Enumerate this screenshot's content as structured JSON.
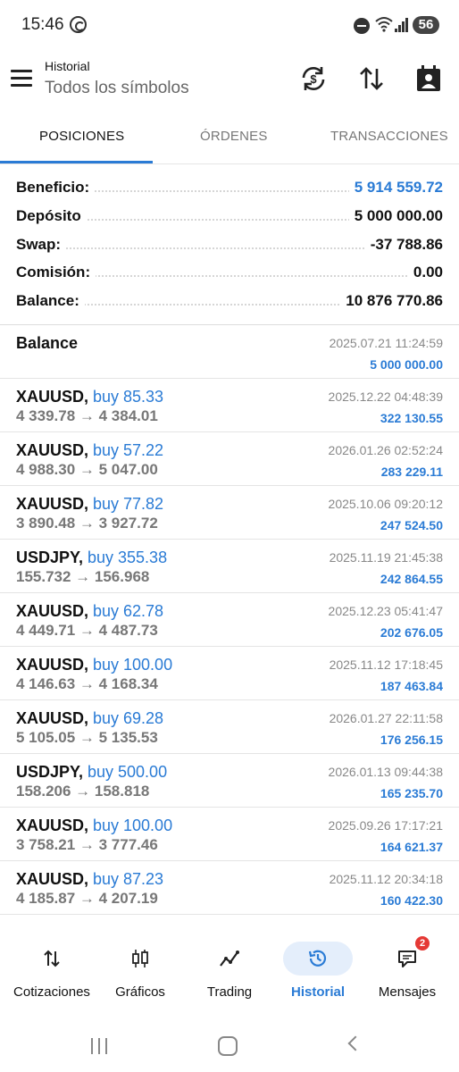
{
  "status_bar": {
    "time": "15:46",
    "battery": "56"
  },
  "app_bar": {
    "title": "Historial",
    "subtitle": "Todos los símbolos",
    "icons": [
      "menu-icon",
      "currency-sync-icon",
      "sort-icon",
      "calendar-person-icon"
    ]
  },
  "tabs": [
    {
      "label": "POSICIONES",
      "active": true
    },
    {
      "label": "ÓRDENES",
      "active": false
    },
    {
      "label": "TRANSACCIONES",
      "active": false
    }
  ],
  "summary": [
    {
      "label": "Beneficio:",
      "value": "5 914 559.72",
      "accent": true
    },
    {
      "label": "Depósito",
      "value": "5 000 000.00",
      "accent": false
    },
    {
      "label": "Swap:",
      "value": "-37 788.86",
      "accent": false
    },
    {
      "label": "Comisión:",
      "value": "0.00",
      "accent": false
    },
    {
      "label": "Balance:",
      "value": "10 876 770.86",
      "accent": false
    }
  ],
  "balance_entry": {
    "title": "Balance",
    "time": "2025.07.21 11:24:59",
    "amount": "5 000 000.00"
  },
  "deals": [
    {
      "symbol": "XAUUSD,",
      "side": "buy 85.33",
      "prices": "4 339.78 → 4 384.01",
      "time": "2025.12.22 04:48:39",
      "profit": "322 130.55"
    },
    {
      "symbol": "XAUUSD,",
      "side": "buy 57.22",
      "prices": "4 988.30 → 5 047.00",
      "time": "2026.01.26 02:52:24",
      "profit": "283 229.11"
    },
    {
      "symbol": "XAUUSD,",
      "side": "buy 77.82",
      "prices": "3 890.48 → 3 927.72",
      "time": "2025.10.06 09:20:12",
      "profit": "247 524.50"
    },
    {
      "symbol": "USDJPY,",
      "side": "buy 355.38",
      "prices": "155.732 → 156.968",
      "time": "2025.11.19 21:45:38",
      "profit": "242 864.55"
    },
    {
      "symbol": "XAUUSD,",
      "side": "buy 62.78",
      "prices": "4 449.71 → 4 487.73",
      "time": "2025.12.23 05:41:47",
      "profit": "202 676.05"
    },
    {
      "symbol": "XAUUSD,",
      "side": "buy 100.00",
      "prices": "4 146.63 → 4 168.34",
      "time": "2025.11.12 17:18:45",
      "profit": "187 463.84"
    },
    {
      "symbol": "XAUUSD,",
      "side": "buy 69.28",
      "prices": "5 105.05 → 5 135.53",
      "time": "2026.01.27 22:11:58",
      "profit": "176 256.15"
    },
    {
      "symbol": "USDJPY,",
      "side": "buy 500.00",
      "prices": "158.206 → 158.818",
      "time": "2026.01.13 09:44:38",
      "profit": "165 235.70"
    },
    {
      "symbol": "XAUUSD,",
      "side": "buy 100.00",
      "prices": "3 758.21 → 3 777.46",
      "time": "2025.09.26 17:17:21",
      "profit": "164 621.37"
    },
    {
      "symbol": "XAUUSD,",
      "side": "buy 87.23",
      "prices": "4 185.87 → 4 207.19",
      "time": "2025.11.12 20:34:18",
      "profit": "160 422.30"
    }
  ],
  "bottom_nav": [
    {
      "label": "Cotizaciones",
      "icon": "quotes-arrows-icon",
      "active": false
    },
    {
      "label": "Gráficos",
      "icon": "candlestick-icon",
      "active": false
    },
    {
      "label": "Trading",
      "icon": "trend-line-icon",
      "active": false
    },
    {
      "label": "Historial",
      "icon": "history-clock-icon",
      "active": true
    },
    {
      "label": "Mensajes",
      "icon": "chat-icon",
      "active": false,
      "badge": "2"
    }
  ],
  "colors": {
    "accent": "#2a7bd5",
    "badge": "#e53935",
    "active_nav_bg": "#e4eefb"
  }
}
